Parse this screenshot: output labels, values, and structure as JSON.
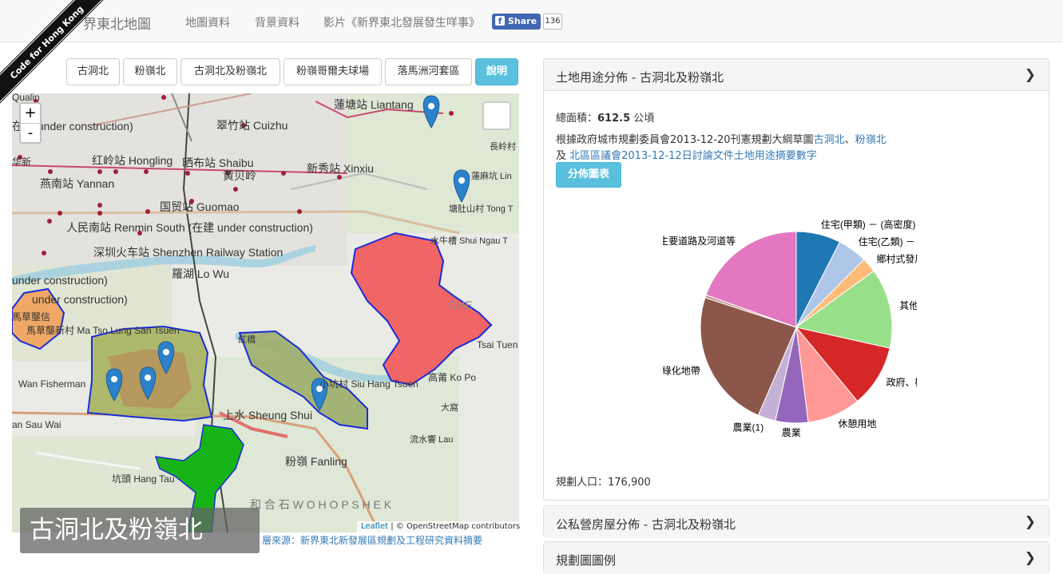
{
  "header": {
    "brand": "界東北地圖",
    "nav": [
      "地圖資料",
      "背景資料",
      "影片《新界東北發展發生咩事》"
    ],
    "share_label": "Share",
    "share_count": "136",
    "ribbon": "Code for Hong Kong"
  },
  "area_buttons": [
    "古洞北",
    "粉嶺北",
    "古洞北及粉嶺北",
    "粉嶺哥爾夫球場",
    "落馬洲河套區"
  ],
  "help_button": "說明",
  "map": {
    "zoom_in": "+",
    "zoom_out": "-",
    "labels": [
      "蓮塘站 Liantang",
      "在建 under construction)",
      "翠竹站 Cuizhu",
      "红岭站 Hongling",
      "晒布站 Shaibu",
      "黄贝岭",
      "新秀站 Xinxiu",
      "燕南站 Yannan",
      "国贸站 Guomao",
      "人民南站 Renmin South (在建 under construction)",
      "深圳火车站 Shenzhen Railway Station",
      "羅湖 Lo Wu",
      "蓮麻坑 Lin",
      "塘肚山村 Tong T",
      "水牛槽 Shui Ngau T",
      "長岭村",
      "under construction)",
      "under construction)",
      "馬草壟新村 Ma Tso Lung San Tsuen",
      "Tsai Tuen",
      "馬草壟信",
      "高莆 Ko Po",
      "Wan Fisherman",
      "小坑村 Siu Hang Tsuen",
      "上水 Sheung Shui",
      "大窩",
      "an Sau Wai",
      "流水響 Lau",
      "粉嶺 Fanling",
      "坑頭 Hang Tau",
      "和 合 石  W O  H O P  S H E K",
      "CHE",
      "Qualin",
      "华新",
      "紅橋"
    ],
    "attribution_leaflet": "Leaflet",
    "attribution_osm": "| © OpenStreetMap contributors",
    "title": "古洞北及粉嶺北",
    "source": "層來源：新界東北新發展區規劃及工程研究資料摘要"
  },
  "panel_landuse": {
    "title": "土地用途分佈 - 古洞北及粉嶺北",
    "area_label": "總面積：",
    "area_value": "612.5",
    "area_unit": " 公頃",
    "desc_prefix": "根據政府城市規劃委員會2013-12-20刊憲規劃大綱草圖",
    "link1": "古洞北",
    "sep": "、",
    "link2": "粉嶺北",
    "and": "及 ",
    "link3": "北區區議會2013-12-12日討論文件土地用途摘要數字",
    "chart_button": "分佈圖表",
    "population_label": "規劃人口：",
    "population_value": "176,900"
  },
  "panel_housing": {
    "title": "公私營房屋分佈 - 古洞北及粉嶺北"
  },
  "panel_legend": {
    "title": "規劃圖圖例"
  },
  "chart_data": {
    "type": "pie",
    "title": "",
    "slices": [
      {
        "label": "住宅(甲類) － (高密度)",
        "value": 7.5,
        "color": "#1f77b4"
      },
      {
        "label": "住宅(乙類) － (中密度)",
        "value": 5.0,
        "color": "#aec7e8"
      },
      {
        "label": "鄉村式發展",
        "value": 2.5,
        "color": "#ffbb78"
      },
      {
        "label": "其他指定",
        "value": 13.5,
        "color": "#98df8a"
      },
      {
        "label": "政府、機構或社",
        "value": 10.5,
        "color": "#d62728"
      },
      {
        "label": "休憩用地",
        "value": 9.0,
        "color": "#ff9896"
      },
      {
        "label": "農業",
        "value": 5.5,
        "color": "#9467bd"
      },
      {
        "label": "農業(1)",
        "value": 3.0,
        "color": "#c5b0d5"
      },
      {
        "label": "綠化地帶",
        "value": 23.5,
        "color": "#8c564b"
      },
      {
        "label": "",
        "value": 0.5,
        "color": "#c49c94"
      },
      {
        "label": "主要道路及河道等",
        "value": 19.5,
        "color": "#e377c2"
      }
    ]
  }
}
